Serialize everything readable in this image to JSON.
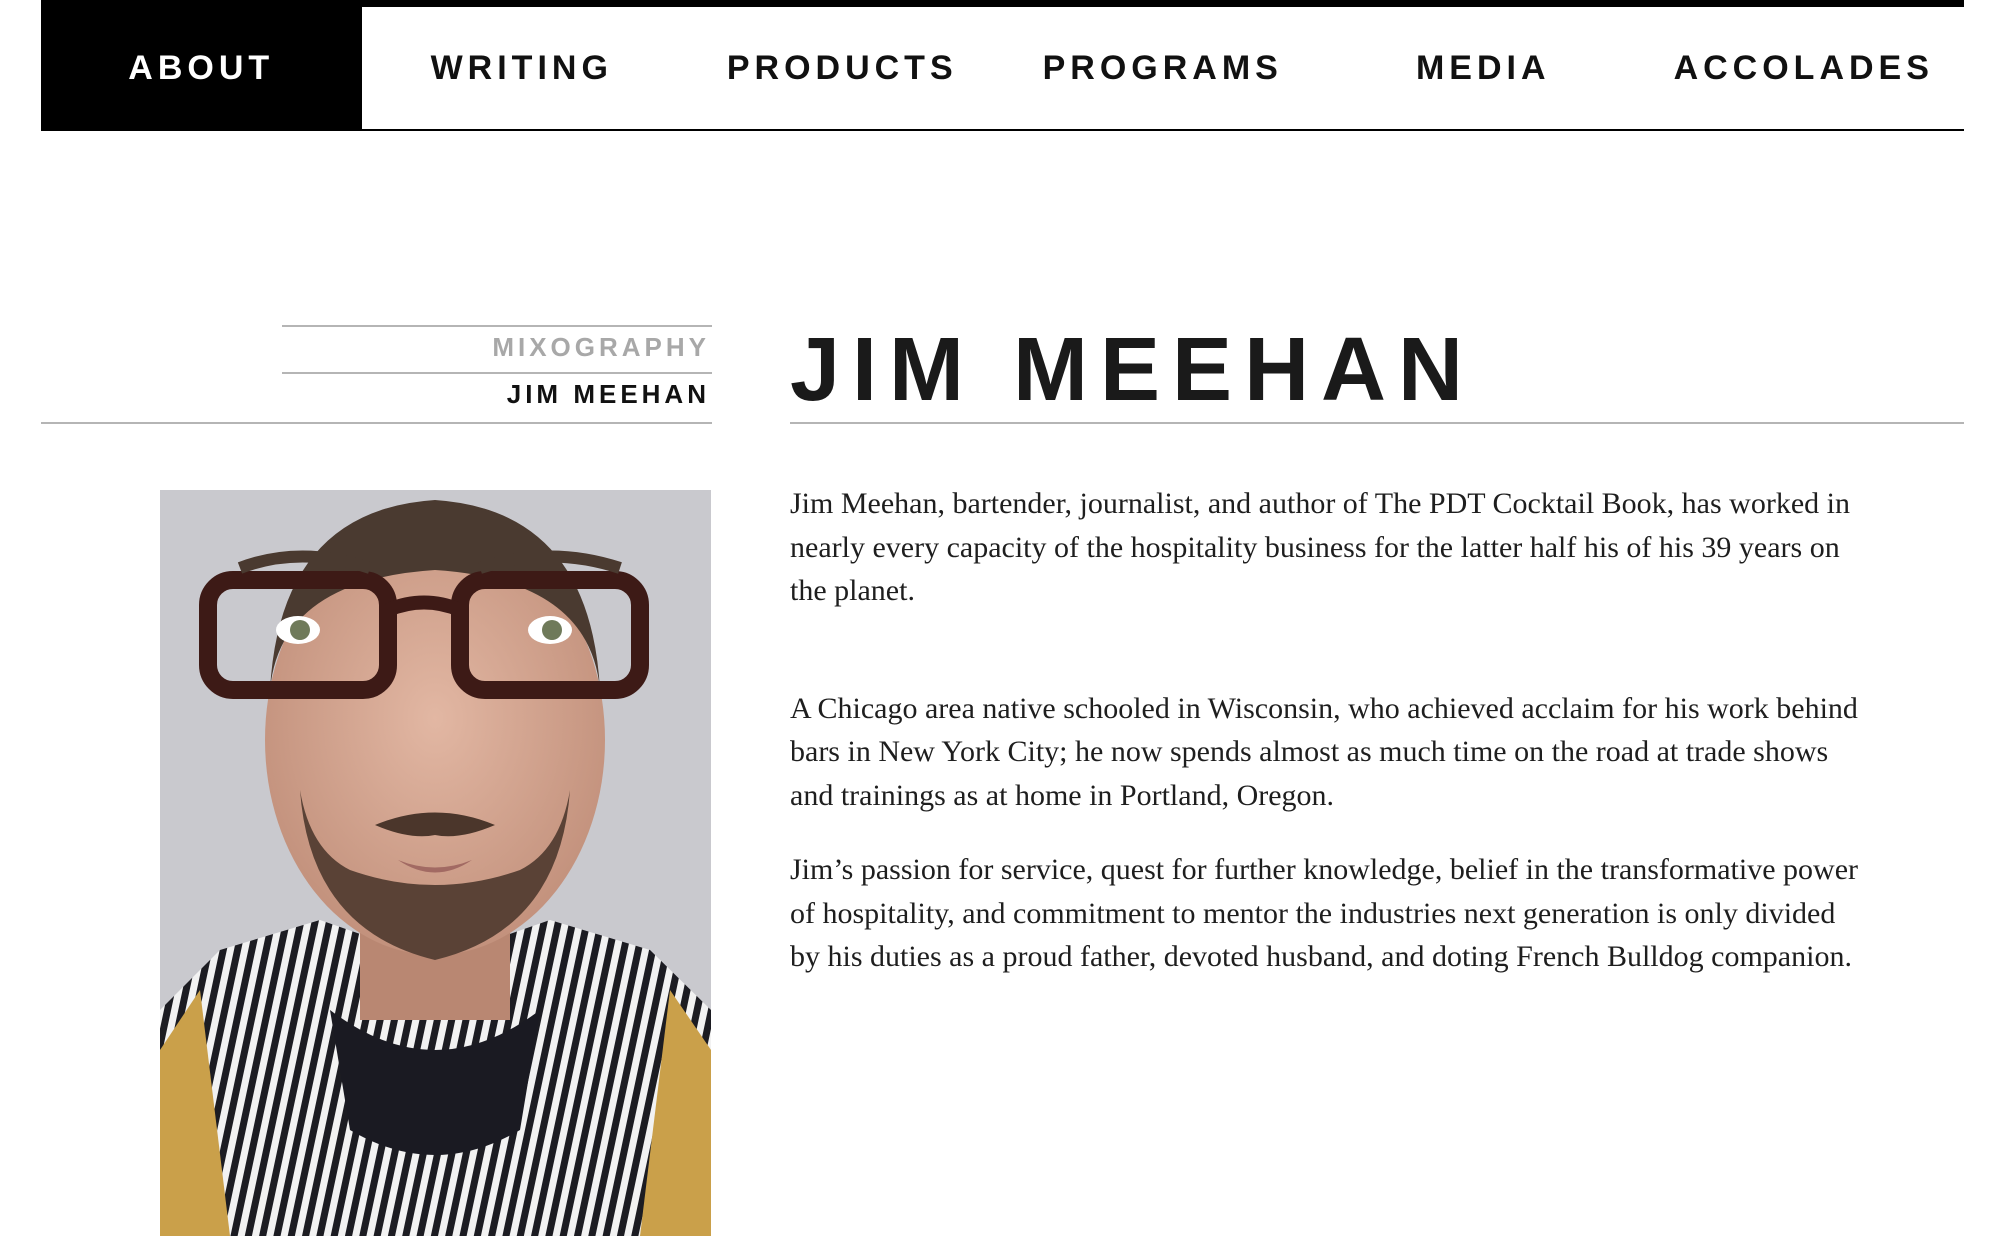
{
  "nav": {
    "items": [
      {
        "label": "ABOUT",
        "active": true
      },
      {
        "label": "WRITING",
        "active": false
      },
      {
        "label": "PRODUCTS",
        "active": false
      },
      {
        "label": "PROGRAMS",
        "active": false
      },
      {
        "label": "MEDIA",
        "active": false
      },
      {
        "label": "ACCOLADES",
        "active": false
      }
    ]
  },
  "breadcrumb": {
    "parent": "MIXOGRAPHY",
    "current": "JIM MEEHAN"
  },
  "page": {
    "title": "JIM MEEHAN",
    "portrait_alt": "Portrait of Jim Meehan"
  },
  "bio": {
    "paragraphs": [
      "Jim Meehan, bartender, journalist, and author of The PDT Cocktail Book, has worked in nearly every capacity of the hospitality business for the latter half his of his 39 years on the planet.",
      "A Chicago area native schooled in Wisconsin, who achieved acclaim for his work behind bars in New York City; he now spends almost as much time on the road at trade shows and trainings as at home in Portland, Oregon.",
      "Jim’s passion for service, quest for further knowledge, belief in the transformative power of hospitality, and commitment to mentor the industries next generation is only divided by his duties as a proud father, devoted husband, and doting French Bulldog companion."
    ]
  },
  "colors": {
    "nav_active_bg": "#000000",
    "nav_active_text": "#ffffff",
    "text": "#1e1e1e",
    "muted": "#a8a8a8",
    "rule": "#b5b5b5"
  }
}
